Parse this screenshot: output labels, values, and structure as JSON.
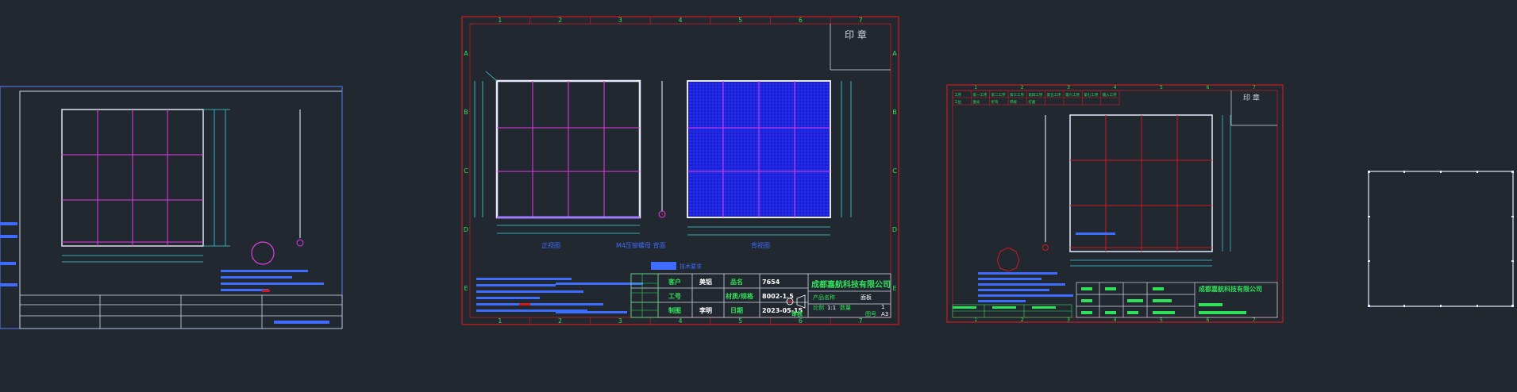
{
  "colors": {
    "background": "#212830",
    "frame_red": "#d0191f",
    "frame_blue": "#5c7cff",
    "white": "#ffffff",
    "magenta": "#e23ce6",
    "green": "#31e05a",
    "blue_label": "#3d6cff",
    "fill_blue": "#1a1ad6",
    "grid_cyan": "#3ad6e6",
    "light": "#d5d7e6"
  },
  "sheet2": {
    "col_numbers": [
      "1",
      "2",
      "3",
      "4",
      "5",
      "6",
      "7"
    ],
    "row_letters": [
      "A",
      "B",
      "C",
      "D",
      "E"
    ],
    "stamp_label": "印  章",
    "company": "成都嘉航科技有限公司",
    "title_block": {
      "customer_label": "客户",
      "customer_value": "美铝",
      "product_label": "品名",
      "product_value": "7654",
      "process_label": "工号",
      "material_label": "材质/规格",
      "material_value": "8002-1.5",
      "date_label": "日期",
      "date_value": "2023-05-15",
      "prepared_label": "制图",
      "prepared_value": "李明",
      "reviewed_label": "审核",
      "product_name_label": "产品名称",
      "product_name_value": "面板",
      "scale_label": "比例",
      "scale_value": "1:1",
      "qty_label": "数量",
      "qty_value": "1",
      "page_label": "图号",
      "page_value": "A3"
    },
    "caption_left": "正视图",
    "caption_mid": "M4压铆螺母 背面",
    "caption_right": "背视图",
    "legend_title": "技术要求"
  },
  "sheet3": {
    "col_numbers": [
      "1",
      "2",
      "3",
      "4",
      "5",
      "6",
      "7"
    ],
    "stamp_label": "印  章",
    "company": "成都嘉航科技有限公司",
    "header_row1": [
      "工序",
      "第一工序",
      "第二工序",
      "第三工序",
      "第四工序",
      "第五工序",
      "第六工序",
      "第七工序",
      "输入工序"
    ],
    "header_row2": [
      "工位",
      "激光",
      "折弯",
      "焊接",
      "打磨"
    ]
  }
}
